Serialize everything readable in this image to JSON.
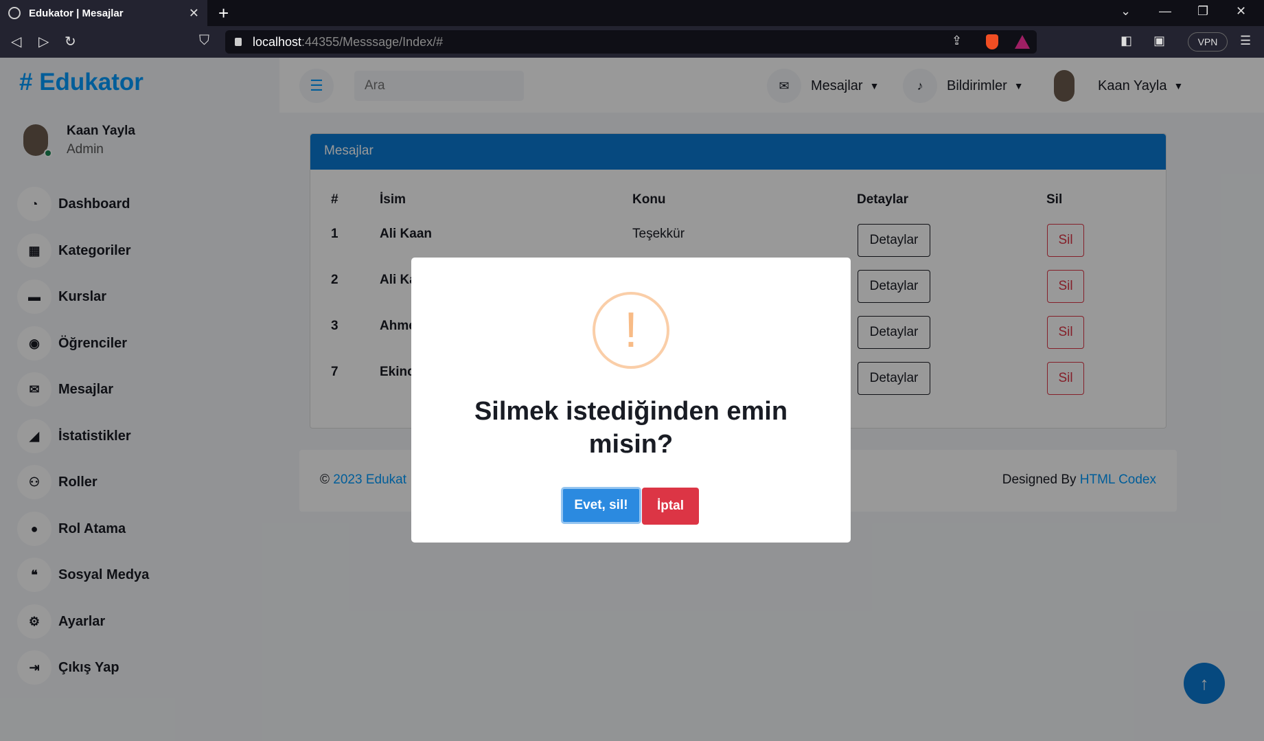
{
  "browser": {
    "tab_title": "Edukator | Mesajlar",
    "tab_close": "✕",
    "new_tab": "+",
    "url_host": "localhost",
    "url_rest": ":44355/Messsage/Index/#",
    "vpn_label": "VPN"
  },
  "sidebar": {
    "brand": "# Edukator",
    "user_name": "Kaan Yayla",
    "user_role": "Admin",
    "items": [
      {
        "label": "Dashboard",
        "icon": "tachometer-icon",
        "glyph": "◔"
      },
      {
        "label": "Kategoriler",
        "icon": "grid-icon",
        "glyph": "▦"
      },
      {
        "label": "Kurslar",
        "icon": "folder-icon",
        "glyph": "▬"
      },
      {
        "label": "Öğrenciler",
        "icon": "user-circle-icon",
        "glyph": "◉"
      },
      {
        "label": "Mesajlar",
        "icon": "envelope-icon",
        "glyph": "✉"
      },
      {
        "label": "İstatistikler",
        "icon": "area-chart-icon",
        "glyph": "◢"
      },
      {
        "label": "Roller",
        "icon": "user-plus-icon",
        "glyph": "⚇"
      },
      {
        "label": "Rol Atama",
        "icon": "user-icon",
        "glyph": "●"
      },
      {
        "label": "Sosyal Medya",
        "icon": "comments-icon",
        "glyph": "❝"
      },
      {
        "label": "Ayarlar",
        "icon": "cog-icon",
        "glyph": "⚙"
      },
      {
        "label": "Çıkış Yap",
        "icon": "sign-out-icon",
        "glyph": "⇥"
      }
    ]
  },
  "topnav": {
    "search_placeholder": "Ara",
    "messages_label": "Mesajlar",
    "notifications_label": "Bildirimler",
    "user_name": "Kaan Yayla"
  },
  "messages_card": {
    "title": "Mesajlar",
    "columns": [
      "#",
      "İsim",
      "Konu",
      "Detaylar",
      "Sil"
    ],
    "rows": [
      {
        "id": "1",
        "name": "Ali Kaan",
        "subject": "Teşekkür"
      },
      {
        "id": "2",
        "name": "Ali Ka",
        "subject": ""
      },
      {
        "id": "3",
        "name": "Ahme",
        "subject": ""
      },
      {
        "id": "7",
        "name": "Ekinc",
        "subject": ""
      }
    ],
    "details_label": "Detaylar",
    "delete_label": "Sil"
  },
  "footer": {
    "copyright_symbol": "©",
    "copyright_link": "2023 Edukat",
    "designed_by": "Designed By",
    "designer_link": "HTML Codex"
  },
  "dialog": {
    "icon": "!",
    "title": "Silmek istediğinden emin misin?",
    "confirm_label": "Evet, sil!",
    "cancel_label": "İptal"
  },
  "colors": {
    "primary": "#009cff",
    "card_header": "#0a7ad4",
    "danger": "#dc3545",
    "warning_icon": "#f8bb86",
    "confirm_button": "#2b8ae0"
  }
}
